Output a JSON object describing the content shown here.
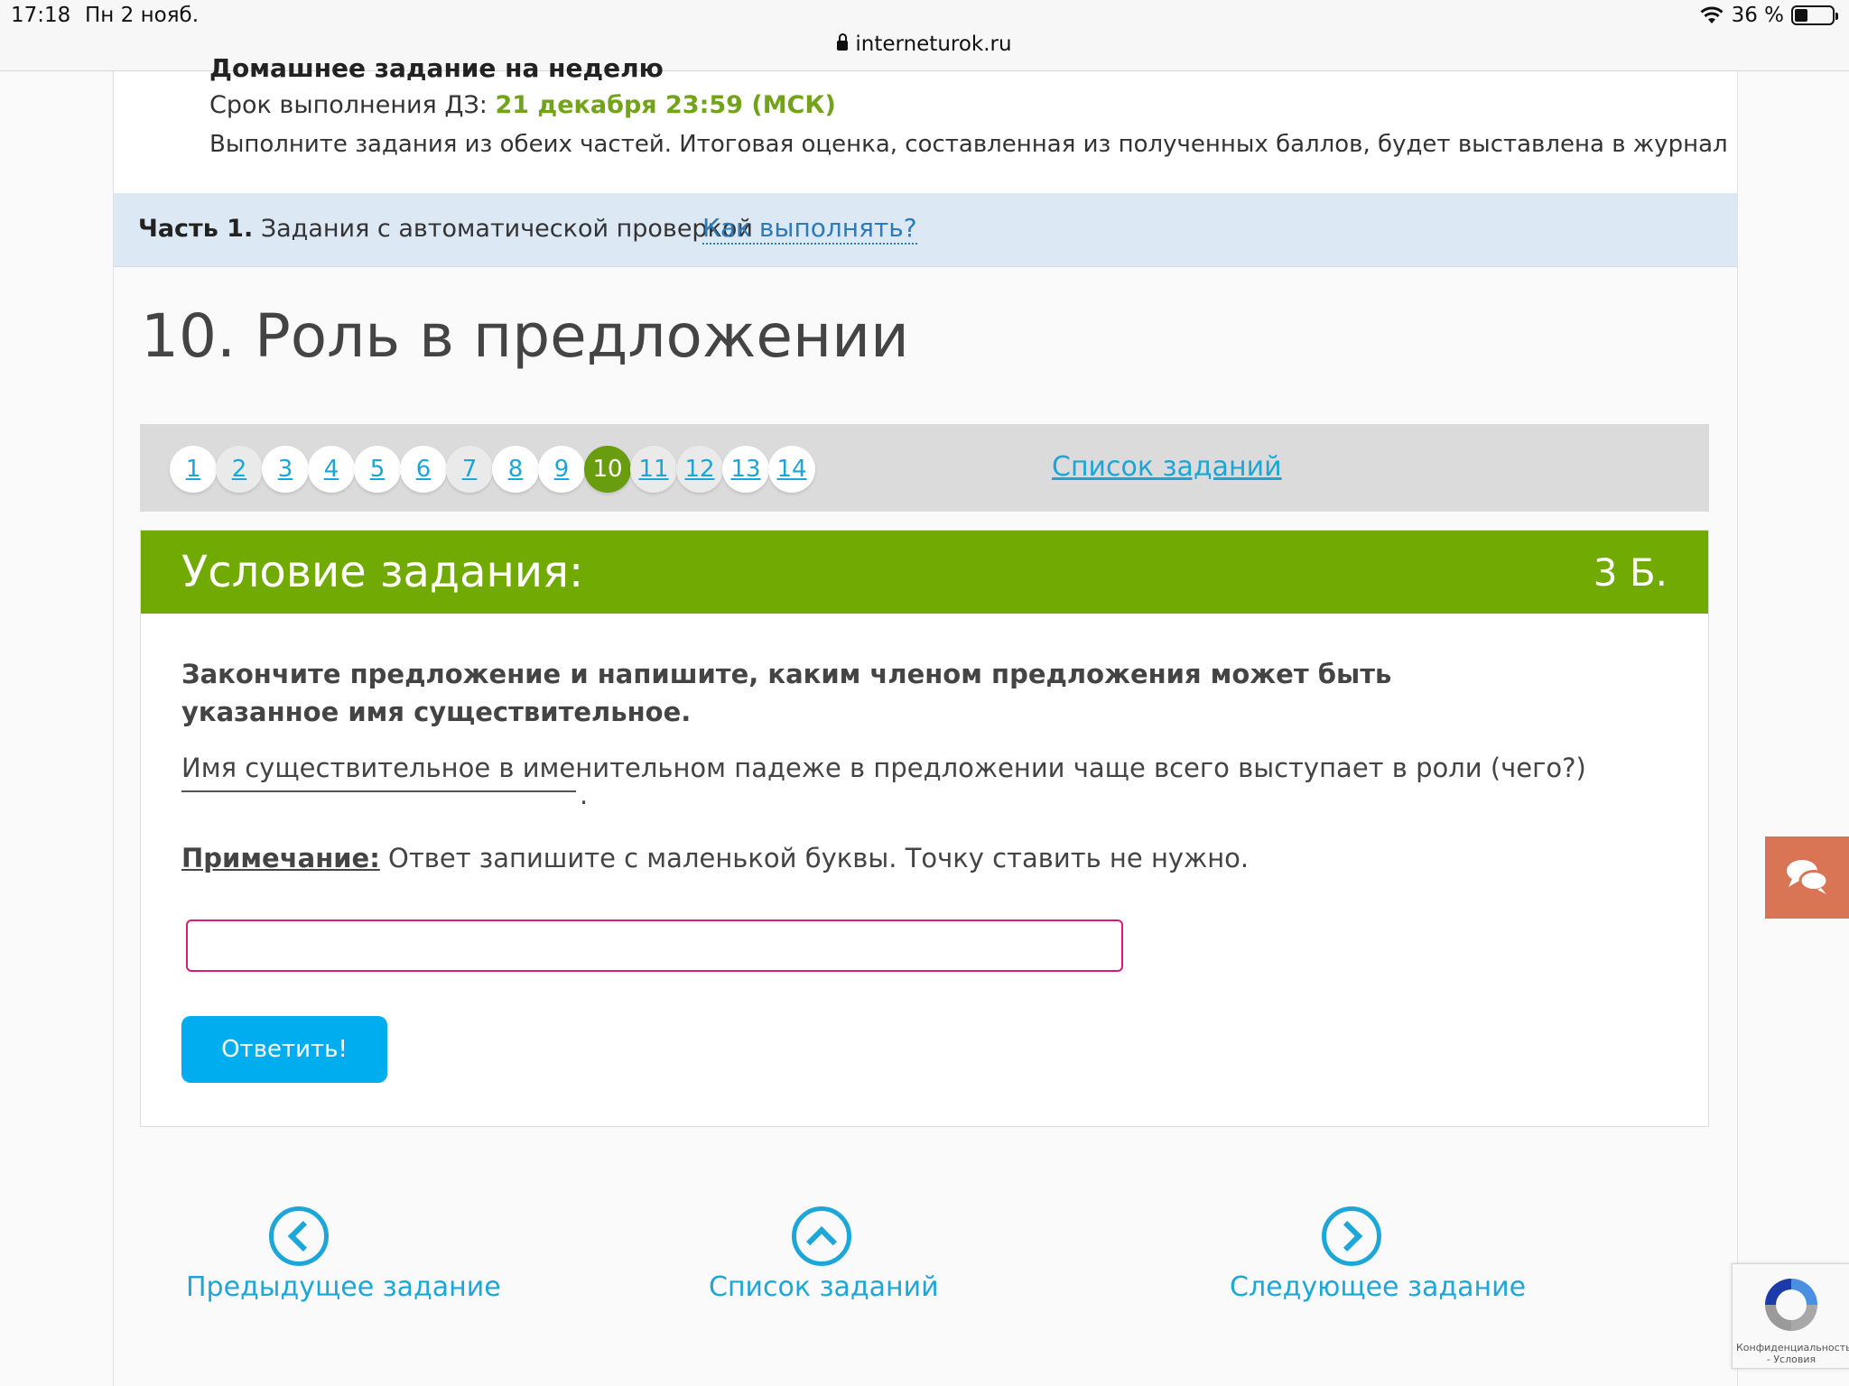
{
  "status_bar": {
    "time": "17:18",
    "date": "Пн 2 нояб.",
    "battery": "36 %",
    "url": "interneturok.ru"
  },
  "homework": {
    "title": "Домашнее задание на неделю",
    "deadline_label": "Срок выполнения ДЗ:",
    "deadline_value": "21 декабря 23:59 (МСК)",
    "description": "Выполните задания из обеих частей. Итоговая оценка, составленная из полученных баллов, будет выставлена в журнал"
  },
  "part": {
    "label_bold": "Часть 1.",
    "label": "Задания с автоматической проверкой",
    "help_link": "Как выполнять?"
  },
  "task": {
    "title": "10. Роль в предложении"
  },
  "pager": {
    "pages": [
      "1",
      "2",
      "3",
      "4",
      "5",
      "6",
      "7",
      "8",
      "9",
      "10",
      "11",
      "12",
      "13",
      "14"
    ],
    "active": "10",
    "list_link": "Список заданий"
  },
  "condition": {
    "title": "Условие задания:",
    "score": "3 Б.",
    "instruction": "Закончите предложение и напишите, каким членом предложения может быть указанное имя существительное.",
    "sentence": "Имя существительное в именительном падеже в предложении чаще всего выступает в роли (чего?)",
    "blank_end": ".",
    "note_label": "Примечание:",
    "note_text": " Ответ запишите с маленькой буквы. Точку ставить не нужно.",
    "answer_value": "",
    "submit_label": "Ответить!"
  },
  "navigation": {
    "prev_label": "Предыдущее задание",
    "list_label": "Список заданий",
    "next_label": "Следующее задание"
  },
  "recaptcha": {
    "text": "Конфиденциальность - Условия"
  },
  "icons": {
    "chat": "chat-bubbles-icon",
    "wifi": "wifi-icon",
    "lock": "lock-icon",
    "recaptcha": "recaptcha-icon"
  },
  "colors": {
    "green_header": "#72aa04",
    "link_blue": "#1aa6d8",
    "active_page": "#6a9c0f",
    "submit": "#00aeef",
    "chat": "#d97555"
  }
}
